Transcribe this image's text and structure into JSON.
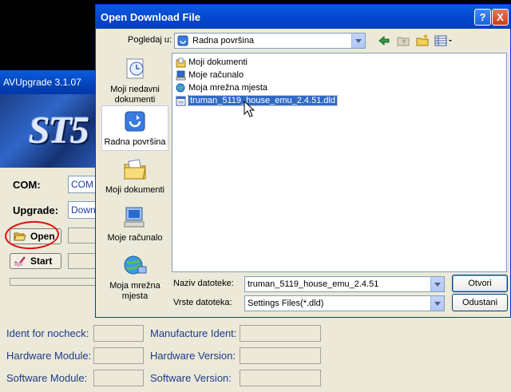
{
  "av_app": {
    "title": "AVUpgrade 3.1.07",
    "banner_text": "ST5",
    "com_label": "COM:",
    "com_value": "COM",
    "upgrade_label": "Upgrade:",
    "upgrade_value": "Down",
    "open_button": "Open",
    "start_button": "Start",
    "info": {
      "ident_nocheck": "Ident for nocheck:",
      "manufacture_ident": "Manufacture Ident:",
      "hardware_module": "Hardware Module:",
      "hardware_version": "Hardware Version:",
      "software_module": "Software Module:",
      "software_version": "Software Version:"
    }
  },
  "dialog": {
    "title": "Open Download File",
    "help_glyph": "?",
    "close_glyph": "X",
    "lookin_label": "Pogledaj u:",
    "lookin_value": "Radna površina",
    "places": [
      {
        "label": "Moji nedavni dokumenti",
        "icon": "recent-documents-icon"
      },
      {
        "label": "Radna površina",
        "icon": "desktop-icon"
      },
      {
        "label": "Moji dokumenti",
        "icon": "my-documents-icon"
      },
      {
        "label": "Moje računalo",
        "icon": "my-computer-icon"
      },
      {
        "label": "Moja mrežna mjesta",
        "icon": "network-places-icon"
      }
    ],
    "files": [
      {
        "name": "Moji dokumenti",
        "icon": "folder-documents-icon",
        "selected": false
      },
      {
        "name": "Moje računalo",
        "icon": "computer-icon",
        "selected": false
      },
      {
        "name": "Moja mrežna mjesta",
        "icon": "network-icon",
        "selected": false
      },
      {
        "name": "truman_5119_house_emu_2.4.51.dld",
        "icon": "file-icon",
        "selected": true
      }
    ],
    "filename_label": "Naziv datoteke:",
    "filename_value": "truman_5119_house_emu_2.4.51",
    "filetype_label": "Vrste datoteka:",
    "filetype_value": "Settings Files(*.dld)",
    "open_button": "Otvori",
    "cancel_button": "Odustani"
  },
  "colors": {
    "titlebar": "#0548d0",
    "selection": "#316ac5",
    "annotation": "#e01010"
  }
}
